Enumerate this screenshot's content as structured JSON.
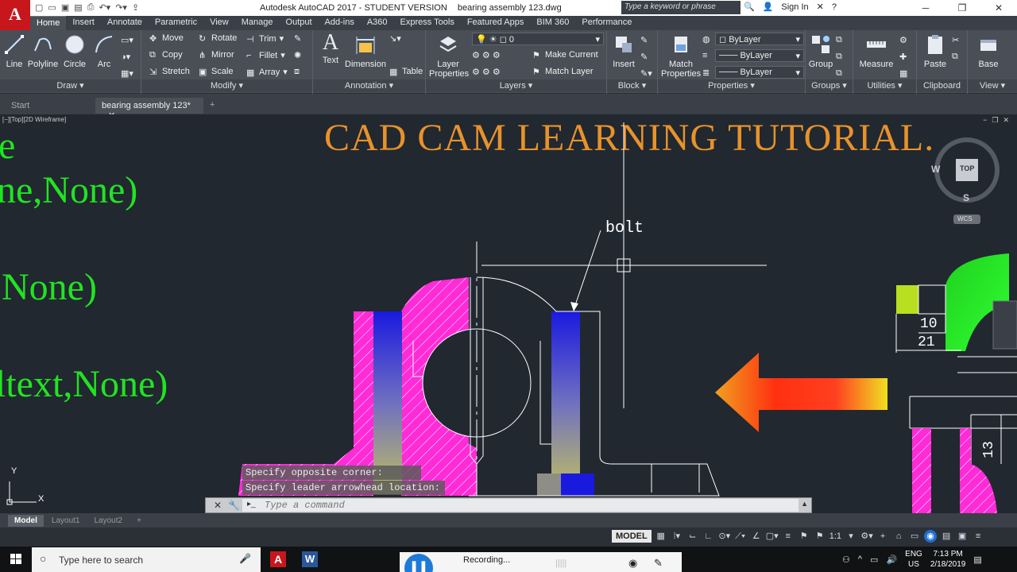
{
  "window": {
    "app_name": "Autodesk AutoCAD 2017 - STUDENT VERSION",
    "file_name": "bearing assembly 123.dwg",
    "logo_letter": "A",
    "search_placeholder": "Type a keyword or phrase",
    "sign_in": "Sign In"
  },
  "ribbon_tabs": [
    "Home",
    "Insert",
    "Annotate",
    "Parametric",
    "View",
    "Manage",
    "Output",
    "Add-ins",
    "A360",
    "Express Tools",
    "Featured Apps",
    "BIM 360",
    "Performance"
  ],
  "draw_panel": {
    "title": "Draw",
    "line": "Line",
    "polyline": "Polyline",
    "circle": "Circle",
    "arc": "Arc"
  },
  "modify_panel": {
    "title": "Modify",
    "move": "Move",
    "rotate": "Rotate",
    "trim": "Trim",
    "copy": "Copy",
    "mirror": "Mirror",
    "fillet": "Fillet",
    "stretch": "Stretch",
    "scale": "Scale",
    "array": "Array"
  },
  "annotation_panel": {
    "title": "Annotation",
    "text": "Text",
    "dimension": "Dimension",
    "table": "Table"
  },
  "layers_panel": {
    "title": "Layers",
    "layer_properties_1": "Layer",
    "layer_properties_2": "Properties",
    "current_layer": "0",
    "make_current": "Make Current",
    "match_layer": "Match Layer"
  },
  "block_panel": {
    "title": "Block",
    "insert": "Insert"
  },
  "properties_panel": {
    "title": "Properties",
    "match_1": "Match",
    "match_2": "Properties",
    "color": "ByLayer",
    "linetype": "ByLayer",
    "lineweight": "ByLayer"
  },
  "groups_panel": {
    "title": "Groups",
    "group": "Group"
  },
  "utilities_panel": {
    "title": "Utilities",
    "measure": "Measure"
  },
  "clipboard_panel": {
    "title": "Clipboard",
    "paste": "Paste"
  },
  "view_panel": {
    "title": "View",
    "base": "Base"
  },
  "file_tabs": {
    "start": "Start",
    "current": "bearing assembly 123*"
  },
  "viewport": {
    "label": "[−][Top][2D Wireframe]",
    "title": "CAD CAM LEARNING TUTORIAL.",
    "left_text": [
      "e",
      "ne,None)",
      ",None)",
      "ltext,None)"
    ],
    "leader_label": "bolt",
    "viewcube": {
      "top": "TOP",
      "west": "W",
      "south": "S",
      "wcs": "WCS"
    },
    "dims": {
      "d10": "10",
      "d21": "21",
      "d13": "13"
    },
    "ucs_x": "X",
    "ucs_y": "Y"
  },
  "command": {
    "history": [
      "Specify opposite corner:",
      "Specify leader arrowhead location:"
    ],
    "placeholder": "Type a command"
  },
  "layout_tabs": [
    "Model",
    "Layout1",
    "Layout2"
  ],
  "status": {
    "model": "MODEL",
    "scale": "1:1"
  },
  "taskbar": {
    "search": "Type here to search",
    "recording": "Recording...",
    "lang_1": "ENG",
    "lang_2": "US",
    "time": "7:13 PM",
    "date": "2/18/2019"
  },
  "colors": {
    "accent_orange": "#e8922b",
    "text_green": "#22e322",
    "magenta_hatch": "#ff2bd6",
    "autocad_red": "#c8161d"
  }
}
